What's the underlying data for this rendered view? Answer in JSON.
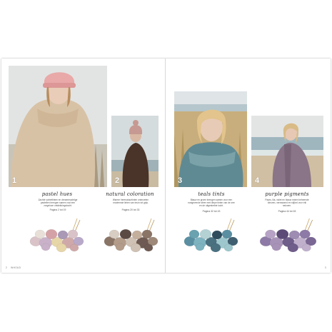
{
  "sections": [
    {
      "number": "1",
      "title": "pastel hues",
      "description": "Zachte sorbettinten en dreamerachtige pastellen brengen samen rust een zorgeloze ontdekkingstocht.",
      "pages": "Pagina 2 tot 19"
    },
    {
      "number": "2",
      "title": "natural coloration",
      "description": "Warme herenatuurtinten ontmoeten modernste linten van bruin tot grijs.",
      "pages": "Pagina 20 tot 33"
    },
    {
      "number": "3",
      "title": "teals tints",
      "description": "Blauw en groen brengen samen voor een rustgevende sfeer met diepe tinten van de zee en de uitgestrekte lucht.",
      "pages": "Pagina 32 tot 43"
    },
    {
      "number": "4",
      "title": "purple pigments",
      "description": "Paars, lila, violet en blauw mixen beheerste kleuren, verrassend en stijlvol voor elk seizoen.",
      "pages": "Pagina 44 tot 63"
    }
  ],
  "footer": {
    "left_page_number": "2",
    "left_brand": "INHOUD",
    "right_page_number": "3"
  },
  "colors": {
    "sweater_beige": "#d8c2a6",
    "hat_pink": "#e8a9a8",
    "coat_brown": "#4a3328",
    "fur_teal": "#5f8a93",
    "cardigan_mauve": "#8a7488",
    "sky": "#e6e8e8",
    "sea": "#9fb6bf"
  },
  "yarn_palettes": [
    [
      "#d9c3c8",
      "#c9b2c9",
      "#e7d6a8",
      "#cfa9a9",
      "#b9a9c9",
      "#e8e0d8",
      "#d4a2a6",
      "#a998b6"
    ],
    [
      "#8a7466",
      "#b39c8a",
      "#cfc1b3",
      "#6e5a52",
      "#9e8878",
      "#d8cdc2",
      "#5b4a44",
      "#c4ae9c"
    ],
    [
      "#5a8fa2",
      "#7eb3c0",
      "#4a7180",
      "#9dc7cc",
      "#3f5f70",
      "#6aa2b0",
      "#b4d1d4",
      "#2f4c5c"
    ],
    [
      "#8d7aa6",
      "#a893b8",
      "#6f5d8a",
      "#c0b0cc",
      "#7a6794",
      "#b6a2c4",
      "#5c4b76",
      "#9e8cb2"
    ]
  ]
}
